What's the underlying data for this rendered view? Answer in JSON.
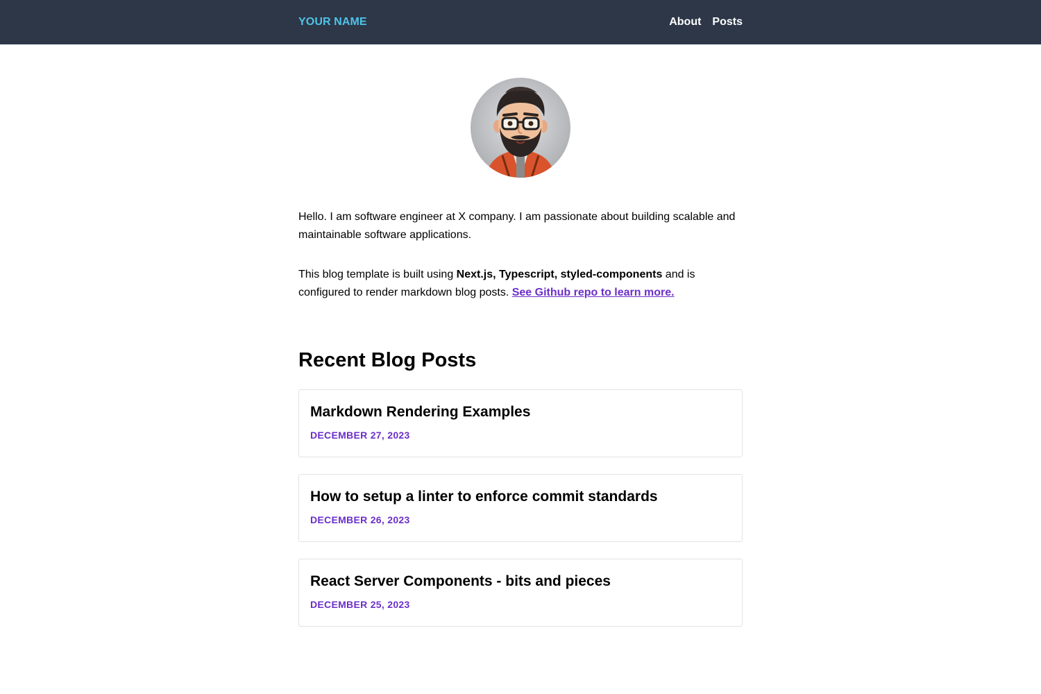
{
  "header": {
    "brand": "YOUR NAME",
    "nav": [
      {
        "label": "About"
      },
      {
        "label": "Posts"
      }
    ]
  },
  "intro": {
    "paragraph1": "Hello. I am software engineer at X company. I am passionate about building scalable and maintainable software applications.",
    "paragraph2_prefix": "This blog template is built using ",
    "paragraph2_bold": "Next.js, Typescript, styled-components",
    "paragraph2_middle": " and is configured to render markdown blog posts. ",
    "paragraph2_link": "See Github repo to learn more."
  },
  "recent": {
    "heading": "Recent Blog Posts",
    "posts": [
      {
        "title": "Markdown Rendering Examples",
        "date": "DECEMBER 27, 2023"
      },
      {
        "title": "How to setup a linter to enforce commit standards",
        "date": "DECEMBER 26, 2023"
      },
      {
        "title": "React Server Components - bits and pieces",
        "date": "DECEMBER 25, 2023"
      }
    ]
  },
  "colors": {
    "navbar_bg": "#2d3748",
    "brand": "#4fc3e8",
    "accent": "#6b2fc9"
  }
}
